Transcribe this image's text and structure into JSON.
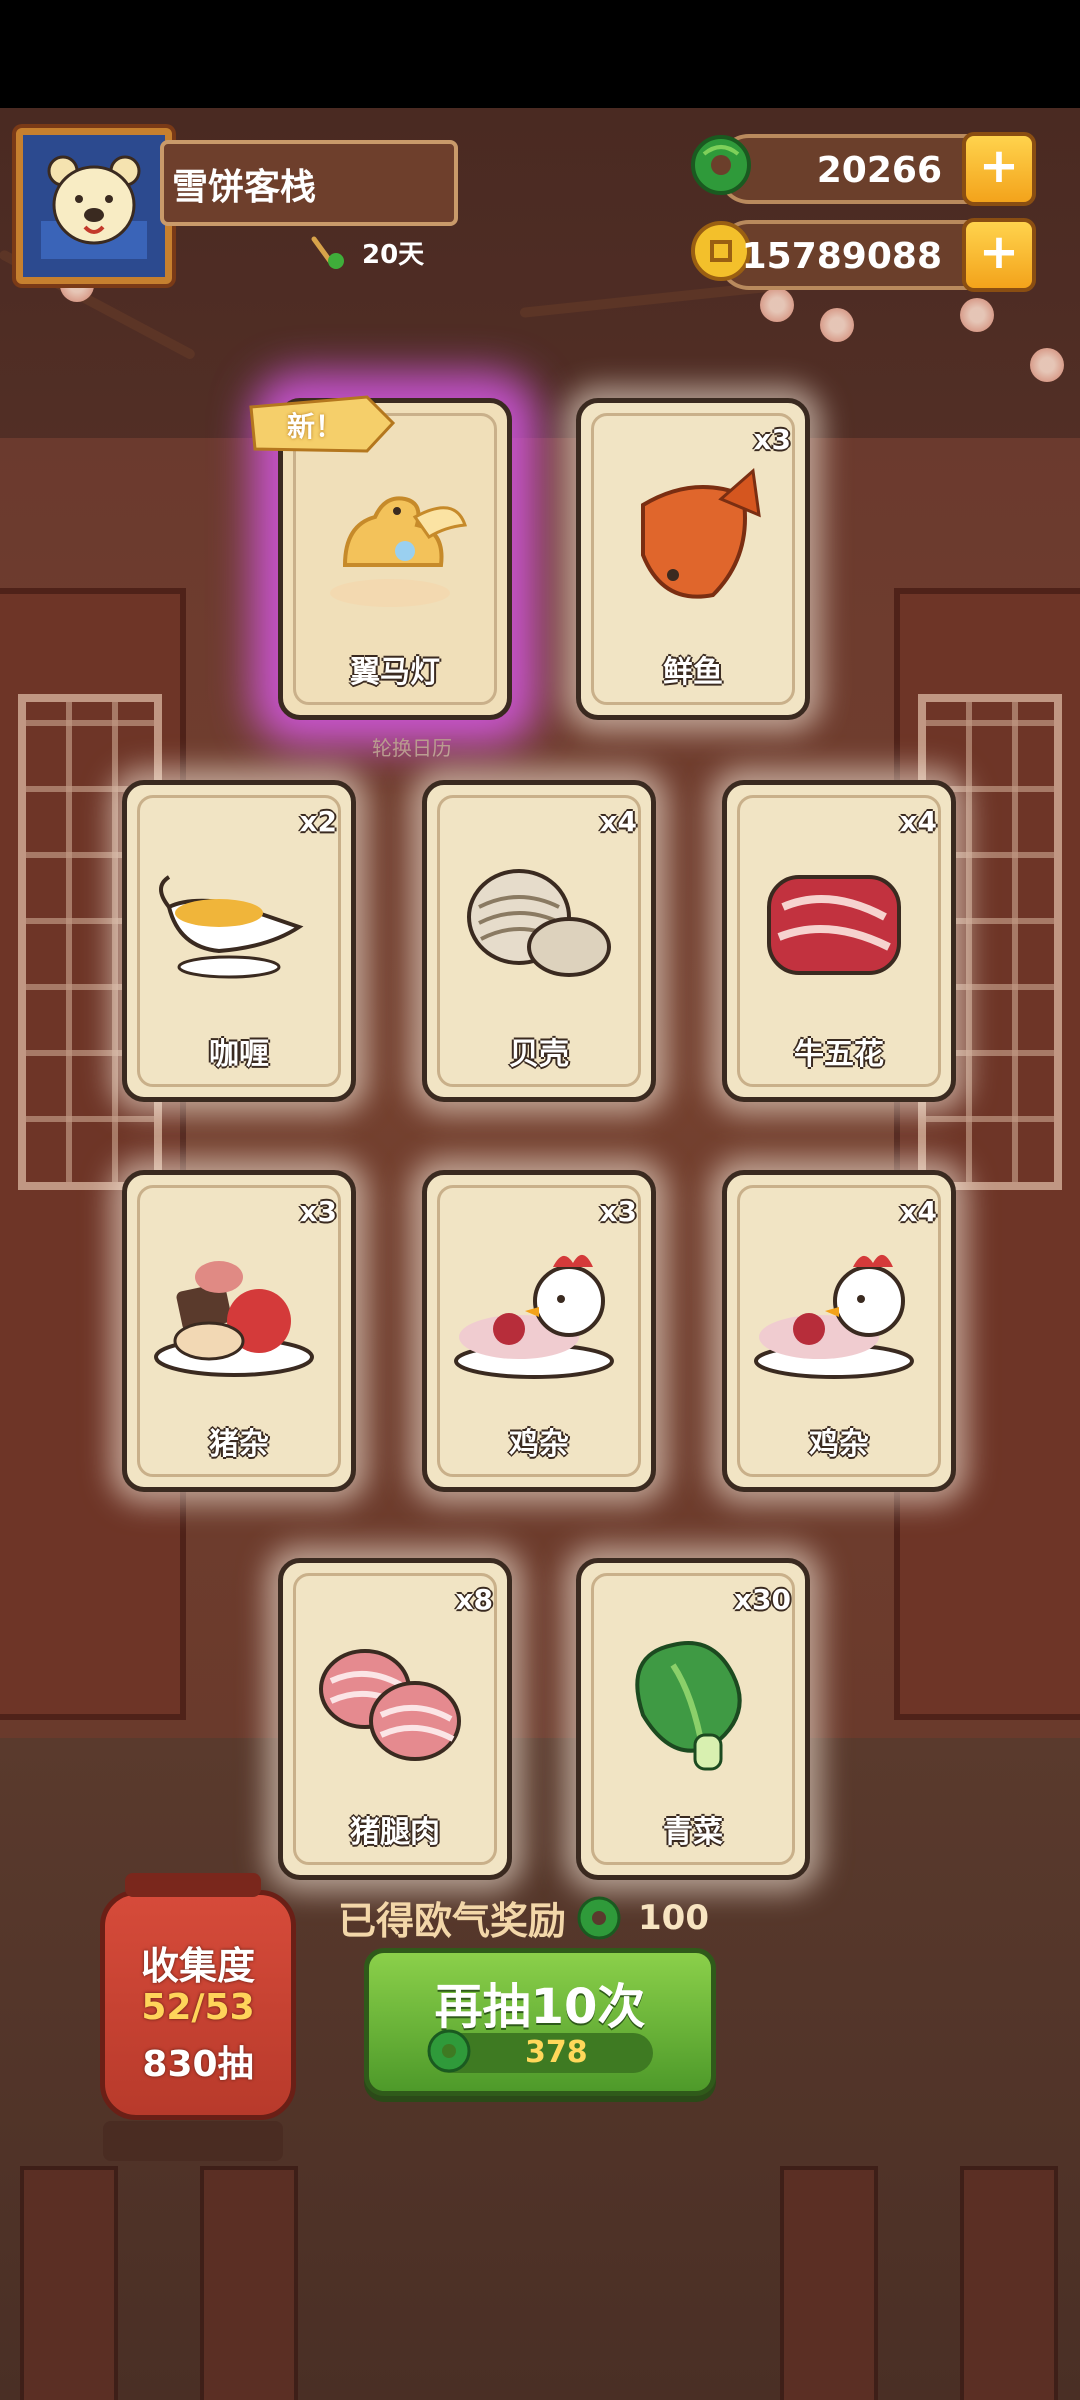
{
  "player": {
    "name": "雪饼客栈",
    "days": "20天"
  },
  "currency": {
    "jade": "20266",
    "coins": "15789088",
    "plus": "+"
  },
  "new_label": "新！",
  "cards": [
    {
      "name": "翼马灯",
      "qty": ""
    },
    {
      "name": "鲜鱼",
      "qty": "x3"
    },
    {
      "name": "咖喱",
      "qty": "x2"
    },
    {
      "name": "贝壳",
      "qty": "x4"
    },
    {
      "name": "牛五花",
      "qty": "x4"
    },
    {
      "name": "猪杂",
      "qty": "x3"
    },
    {
      "name": "鸡杂",
      "qty": "x3"
    },
    {
      "name": "鸡杂",
      "qty": "x4"
    },
    {
      "name": "猪腿肉",
      "qty": "x8"
    },
    {
      "name": "青菜",
      "qty": "x30"
    }
  ],
  "caption": "轮换日历",
  "reward": {
    "label": "已得欧气奖励",
    "amount": "100"
  },
  "collection": {
    "title": "收集度",
    "progress": "52/53",
    "draws": "830抽"
  },
  "draw_button": {
    "label": "再抽10次",
    "cost": "378"
  },
  "colors": {
    "button_green": "#6bb53a",
    "jade_green": "#2f9a3a",
    "gold": "#f3a31b",
    "special_glow": "#d658e6"
  }
}
